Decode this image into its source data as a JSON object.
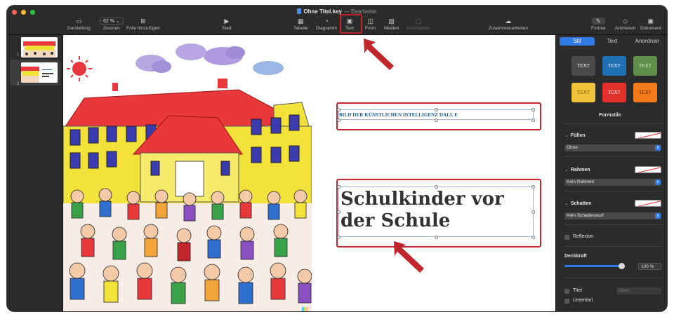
{
  "window": {
    "title": "Ohne Titel.key",
    "status": "Bearbeitet"
  },
  "toolbar": {
    "view_label": "Darstellung",
    "zoom_value": "62 %",
    "zoom_label": "Zoomen",
    "add_slide_label": "Folie hinzufügen",
    "play_label": "Start",
    "table_label": "Tabelle",
    "chart_label": "Diagramm",
    "text_label": "Text",
    "shape_label": "Form",
    "media_label": "Medien",
    "comment_label": "Kommentar",
    "collaborate_label": "Zusammenarbeiten",
    "format_label": "Format",
    "animate_label": "Animieren",
    "document_label": "Dokument"
  },
  "navigator": {
    "slides": [
      {
        "number": "1"
      },
      {
        "number": "2"
      }
    ]
  },
  "slide": {
    "caption": "BILD DER KÜNSTLICHEN INTELLIGENZ DALL E",
    "title": "Schulkinder vor der Schule"
  },
  "inspector": {
    "tabs": [
      "Stil",
      "Text",
      "Anordnen"
    ],
    "active_tab": "Stil",
    "styles": [
      {
        "label": "TEXT",
        "bg": "#4a4a4a",
        "fg": "#ffffff"
      },
      {
        "label": "TEXT",
        "bg": "#1f6fb5",
        "fg": "#ffffff"
      },
      {
        "label": "TEXT",
        "bg": "#5f8f4a",
        "fg": "#d8e6cf"
      },
      {
        "label": "TEXT",
        "bg": "#f0c23a",
        "fg": "#6b4e00"
      },
      {
        "label": "TEXT",
        "bg": "#e4302b",
        "fg": "#ffffff"
      },
      {
        "label": "TEXT",
        "bg": "#f27a1a",
        "fg": "#5a2a00"
      }
    ],
    "styles_label": "Formstile",
    "fill_label": "Füllen",
    "fill_value": "Ohne",
    "border_label": "Rahmen",
    "border_value": "Kein Rahmen",
    "shadow_label": "Schatten",
    "shadow_value": "Kein Schattenwurf",
    "reflection_label": "Reflexion",
    "opacity_label": "Deckkraft",
    "opacity_value": "100 %",
    "opacity_level": 1.0,
    "title_label": "Titel",
    "title_position": "Oben",
    "subtitle_label": "Untertitel"
  },
  "colors": {
    "accent": "#2f7ae5",
    "annotation": "#c0262b"
  }
}
